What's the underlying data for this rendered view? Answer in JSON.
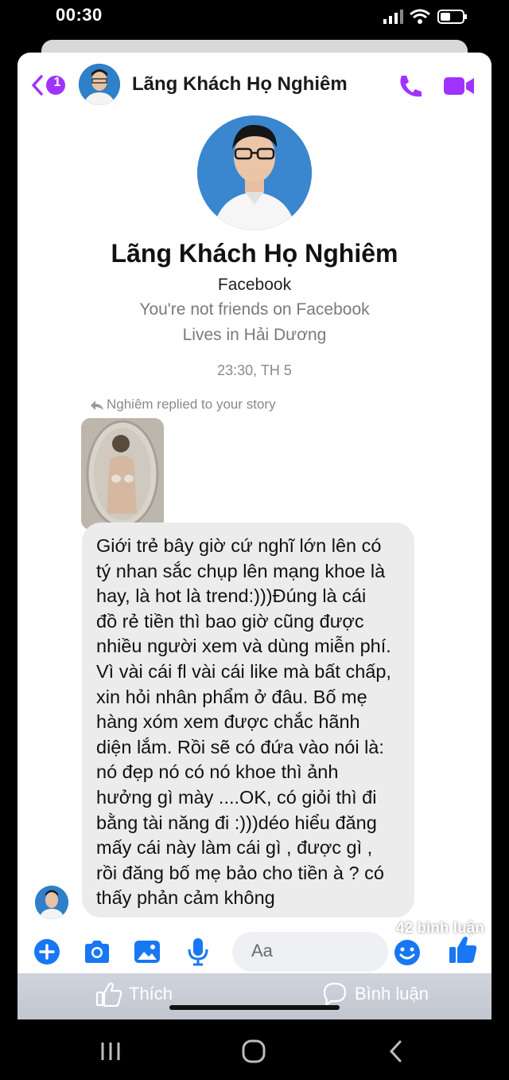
{
  "status_bar": {
    "time": "00:30"
  },
  "header": {
    "back_badge": "1",
    "contact_name": "Lãng Khách Họ Nghiêm"
  },
  "profile": {
    "name": "Lãng Khách Họ Nghiêm",
    "source": "Facebook",
    "friend_status": "You're not friends on Facebook",
    "location": "Lives in Hải Dương"
  },
  "conversation": {
    "timestamp": "23:30, TH 5",
    "reply_note": "Nghiêm replied to your story",
    "message_lines": [
      "Giới trẻ bây giờ cứ nghĩ lớn lên có",
      "tý nhan sắc chụp lên mạng khoe là",
      "hay, là hot là trend:)))Đúng là cái",
      "đồ rẻ tiền thì bao giờ cũng được",
      "nhiều người xem và dùng miễn phí.",
      "Vì vài cái fl vài cái like mà bất chấp,",
      "xin hỏi nhân phẩm ở đâu. Bố mẹ",
      "hàng xóm xem được chắc hãnh",
      "diện lắm. Rồi sẽ có đứa vào nói là:",
      "nó đẹp nó có nó khoe thì ảnh",
      "hưởng gì mày ....OK, có giỏi thì đi",
      "bằng tài năng đi :)))déo hiểu đăng",
      "mấy cái này làm cái gì , được gì ,",
      "rồi đăng bố mẹ bảo cho tiền à ? có",
      "thấy phản cảm không"
    ]
  },
  "composer": {
    "placeholder": "Aa"
  },
  "facebook_bar": {
    "comments_count": "42 bình luận",
    "like_label": "Thích",
    "comment_label": "Bình luận"
  },
  "colors": {
    "accent": "#a033ff",
    "messenger_blue": "#1877f2"
  }
}
